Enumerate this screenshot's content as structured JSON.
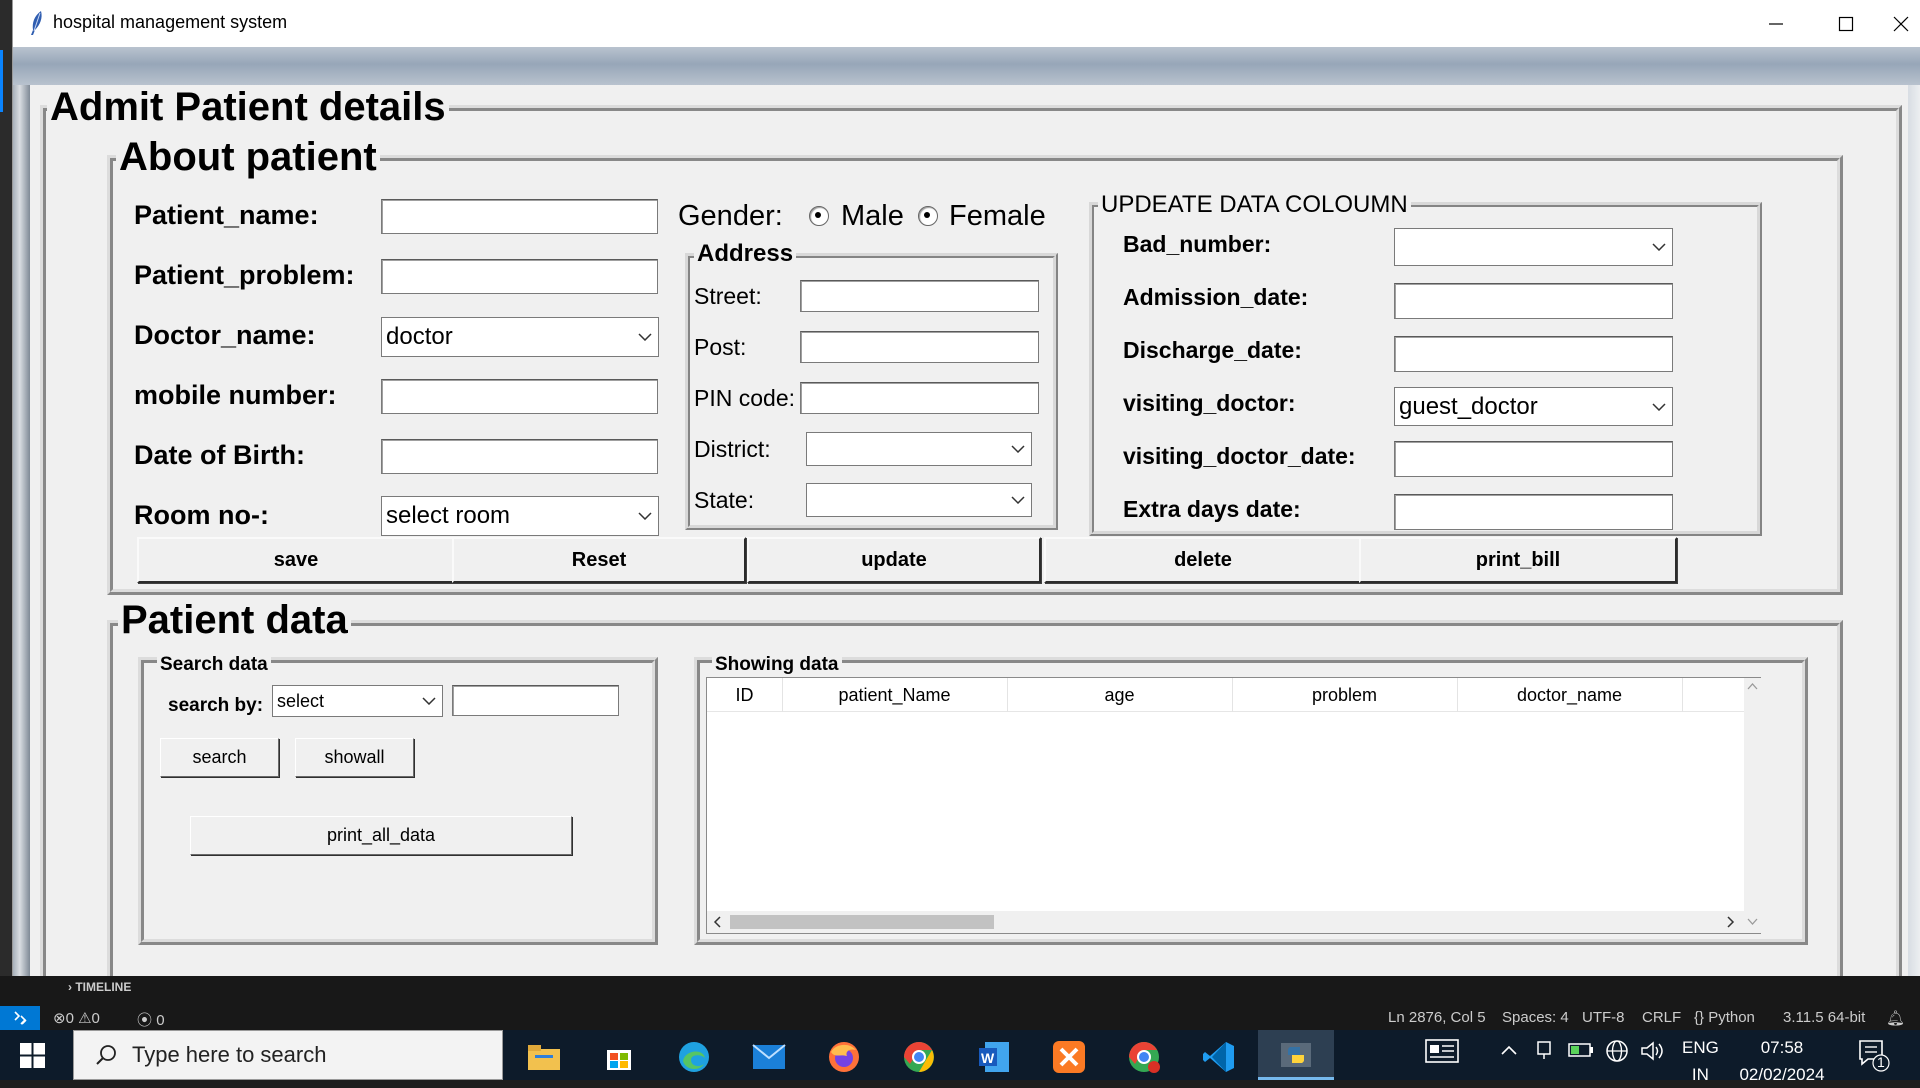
{
  "window": {
    "title": "hospital management system"
  },
  "form": {
    "title": "Admit Patient details",
    "about_title": "About patient",
    "patient_name_label": "Patient_name:",
    "patient_problem_label": "Patient_problem:",
    "doctor_name_label": "Doctor_name:",
    "doctor_name_value": "doctor",
    "mobile_label": "mobile number:",
    "dob_label": "Date of Birth:",
    "room_label": "Room no-:",
    "room_value": "select room",
    "gender_label": "Gender:",
    "male_label": "Male",
    "female_label": "Female",
    "address_title": "Address",
    "street_label": "Street:",
    "post_label": "Post:",
    "pin_label": "PIN code:",
    "district_label": "District:",
    "state_label": "State:",
    "update_title": "UPDEATE DATA  COLOUMN",
    "bad_number_label": "Bad_number:",
    "admission_label": "Admission_date:",
    "discharge_label": "Discharge_date:",
    "visiting_doctor_label": "visiting_doctor:",
    "visiting_doctor_value": "guest_doctor",
    "visiting_doctor_date_label": "visiting_doctor_date:",
    "extra_days_label": "Extra days date:",
    "buttons": {
      "save": "save",
      "reset": "Reset",
      "update": "update",
      "delete": "delete",
      "print_bill": "print_bill"
    }
  },
  "patient_data": {
    "title": "Patient data",
    "search_title": "Search data",
    "search_by_label": "search by:",
    "search_by_value": "select",
    "search_button": "search",
    "showall_button": "showall",
    "print_all_button": "print_all_data",
    "showing_title": "Showing data",
    "columns": [
      "ID",
      "patient_Name",
      "age",
      "problem",
      "doctor_name"
    ]
  },
  "vscode_status": {
    "timeline": "TIMELINE",
    "errors": "0",
    "warnings": "0",
    "ports": "0",
    "position": "Ln 2876, Col 5",
    "spaces": "Spaces: 4",
    "encoding": "UTF-8",
    "eol": "CRLF",
    "language": "Python",
    "interpreter": "3.11.5 64-bit"
  },
  "taskbar": {
    "search_placeholder": "Type here to search",
    "lang_top": "ENG",
    "lang_bottom": "IN",
    "time": "07:58",
    "date": "02/02/2024",
    "notification_count": "1"
  }
}
